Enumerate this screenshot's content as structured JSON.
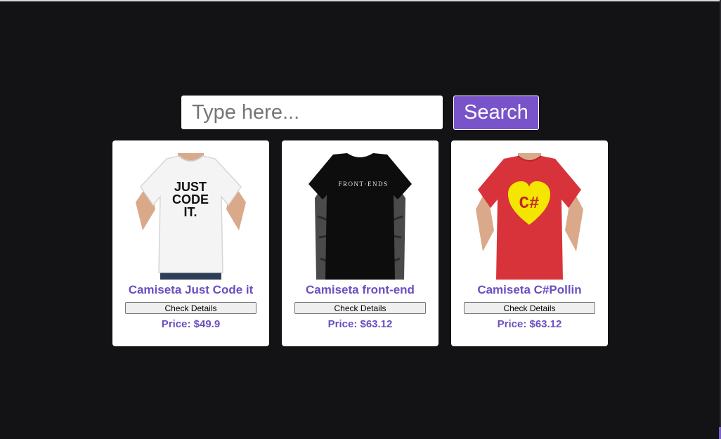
{
  "search": {
    "placeholder": "Type here...",
    "value": "",
    "button_label": "Search"
  },
  "products": [
    {
      "title": "Camiseta Just Code it",
      "button_label": "Check Details",
      "price": "Price: $49.9",
      "image": {
        "shirt_color": "#f4f4f4",
        "print_text": [
          "JUST",
          "CODE",
          "IT."
        ]
      }
    },
    {
      "title": "Camiseta front-end",
      "button_label": "Check Details",
      "price": "Price: $63.12",
      "image": {
        "shirt_color": "#0d0d0d",
        "print_text": [
          "FRONT·ENDS"
        ]
      }
    },
    {
      "title": "Camiseta C#Pollin",
      "button_label": "Check Details",
      "price": "Price: $63.12",
      "image": {
        "shirt_color": "#d8333b",
        "print_text": [
          "C#"
        ]
      }
    }
  ],
  "colors": {
    "background": "#131215",
    "accent": "#7953c9",
    "title_text": "#6b4fc0",
    "card": "#ffffff"
  }
}
